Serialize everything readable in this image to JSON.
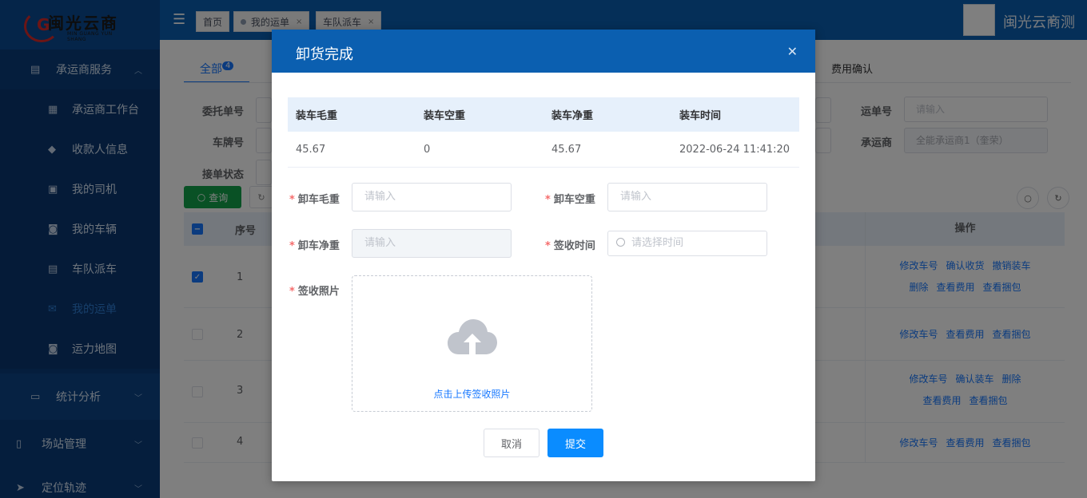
{
  "brand": {
    "logo_text": "闽光云商",
    "logo_sub": "MIN GUANG YUN SHANG"
  },
  "sidebar": {
    "groups": [
      {
        "label": "承运商服务",
        "icon": "calendar-icon"
      },
      {
        "label": "统计分析",
        "icon": "briefcase-icon"
      },
      {
        "label": "场站管理",
        "icon": "building-icon"
      },
      {
        "label": "定位轨迹",
        "icon": "location-icon"
      }
    ],
    "items": [
      {
        "label": "承运商工作台",
        "icon": "dashboard-icon"
      },
      {
        "label": "收款人信息",
        "icon": "user-icon"
      },
      {
        "label": "我的司机",
        "icon": "driver-icon"
      },
      {
        "label": "我的车辆",
        "icon": "vehicle-icon"
      },
      {
        "label": "车队派车",
        "icon": "dispatch-icon"
      },
      {
        "label": "我的运单",
        "icon": "waybill-icon"
      },
      {
        "label": "运力地图",
        "icon": "map-icon"
      }
    ]
  },
  "topbar": {
    "tabs": [
      {
        "label": "首页"
      },
      {
        "label": "我的运单"
      },
      {
        "label": "车队派车"
      }
    ],
    "company": "闽光云商测"
  },
  "page": {
    "tabs": [
      {
        "label": "全部",
        "badge": "4"
      }
    ],
    "tab_right": "费用确认",
    "filters": {
      "order_no_label": "委托单号",
      "plate_label": "车牌号",
      "accept_status_label": "接单状态",
      "waybill_label": "运单号",
      "waybill_placeholder": "请输入",
      "carrier_label": "承运商",
      "carrier_value": "全能承运商1（奎荣）"
    },
    "query_button": "查询",
    "table": {
      "headers": {
        "index": "序号",
        "ops": "操作"
      },
      "rows": [
        {
          "index": "1",
          "checked": true,
          "ops": [
            [
              "修改车号",
              "确认收货",
              "撤销装车"
            ],
            [
              "删除",
              "查看费用",
              "查看捆包"
            ]
          ]
        },
        {
          "index": "2",
          "checked": false,
          "ops": [
            [
              "修改车号",
              "查看费用",
              "查看捆包"
            ]
          ]
        },
        {
          "index": "3",
          "checked": false,
          "ops": [
            [
              "修改车号",
              "确认装车",
              "删除"
            ],
            [
              "查看费用",
              "查看捆包"
            ]
          ]
        },
        {
          "index": "4",
          "checked": false,
          "ops": [
            [
              "修改车号",
              "查看费用",
              "查看捆包"
            ]
          ]
        }
      ]
    }
  },
  "dialog": {
    "title": "卸货完成",
    "table": {
      "headers": [
        "装车毛重",
        "装车空重",
        "装车净重",
        "装车时间"
      ],
      "row": [
        "45.67",
        "0",
        "45.67",
        "2022-06-24 11:41:20"
      ]
    },
    "form": {
      "gross_label": "卸车毛重",
      "gross_placeholder": "请输入",
      "tare_label": "卸车空重",
      "tare_placeholder": "请输入",
      "net_label": "卸车净重",
      "net_placeholder": "请输入",
      "sign_time_label": "签收时间",
      "sign_time_placeholder": "请选择时间",
      "photo_label": "签收照片",
      "upload_text": "点击上传签收照片"
    },
    "cancel_label": "取消",
    "submit_label": "提交"
  }
}
